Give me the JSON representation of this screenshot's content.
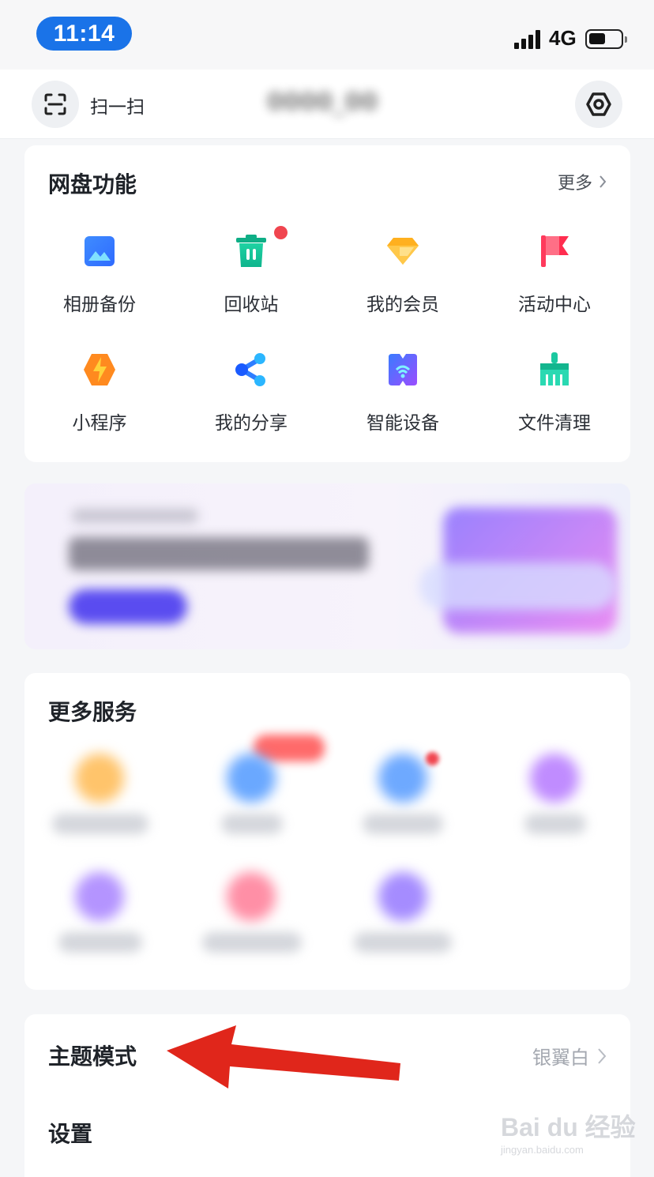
{
  "status_bar": {
    "time": "11:14",
    "network": "4G",
    "battery_level": 0.5
  },
  "header": {
    "scan_label": "扫一扫",
    "username": "0000_00"
  },
  "features": {
    "title": "网盘功能",
    "more_label": "更多",
    "items": [
      {
        "label": "相册备份",
        "icon": "photo-album-icon"
      },
      {
        "label": "回收站",
        "icon": "trash-bin-icon",
        "badge": true
      },
      {
        "label": "我的会员",
        "icon": "vip-diamond-icon"
      },
      {
        "label": "活动中心",
        "icon": "flag-icon"
      },
      {
        "label": "小程序",
        "icon": "mini-program-icon"
      },
      {
        "label": "我的分享",
        "icon": "share-icon"
      },
      {
        "label": "智能设备",
        "icon": "smart-device-icon"
      },
      {
        "label": "文件清理",
        "icon": "broom-icon"
      }
    ]
  },
  "services": {
    "title": "更多服务"
  },
  "theme_row": {
    "label": "主题模式",
    "value": "银翼白"
  },
  "settings_row": {
    "label": "设置"
  },
  "watermark": {
    "brand": "Bai du 经验",
    "url": "jingyan.baidu.com"
  },
  "colors": {
    "accent": "#1a73e8",
    "badge_red": "#f0454f",
    "annotation_arrow": "#e0261b"
  }
}
